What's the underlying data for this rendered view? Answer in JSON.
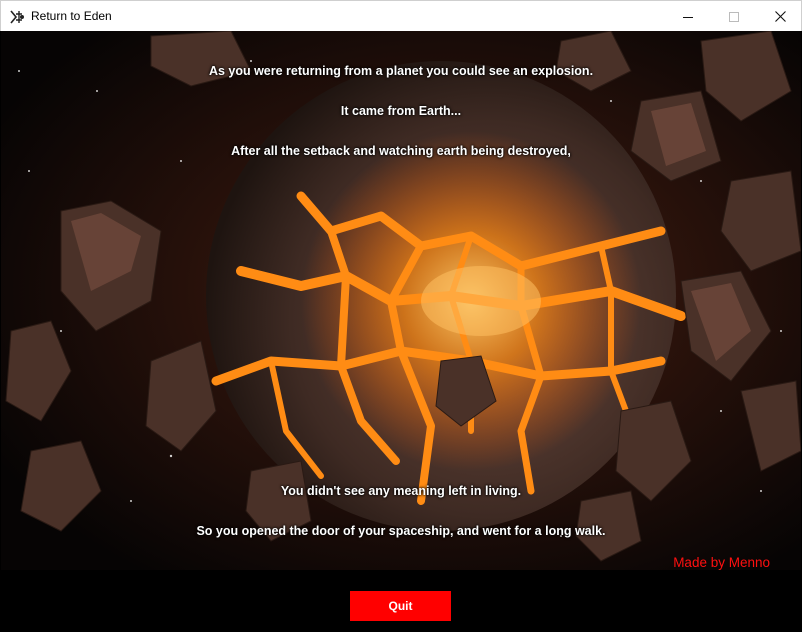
{
  "window": {
    "title": "Return to Eden",
    "icons": {
      "app": "app-icon",
      "minimize": "minimize-icon",
      "maximize": "maximize-icon",
      "close": "close-icon"
    }
  },
  "scene": {
    "background": "exploding-planet",
    "lines": {
      "line1": "As you were returning from a planet you could see an explosion.",
      "line2": "It came from Earth...",
      "line3": "After all the setback and watching earth being destroyed,",
      "line4": "You didn't see any meaning left in living.",
      "line5": "So you opened the door of your spaceship, and went for a long walk."
    },
    "credit": "Made by Menno"
  },
  "controls": {
    "quit_label": "Quit"
  },
  "colors": {
    "quit_button": "#ff0000",
    "credit": "#ff1010",
    "lava": "#ff8a10"
  }
}
